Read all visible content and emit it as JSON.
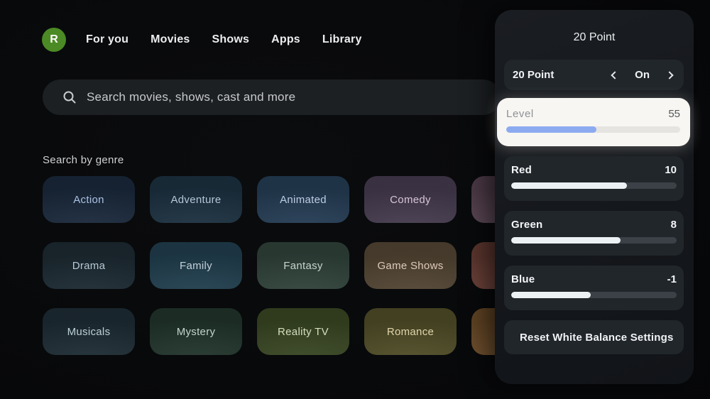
{
  "header": {
    "avatar": {
      "letter": "R",
      "bg": "#4b8a25"
    },
    "nav_items": [
      {
        "label": "For you"
      },
      {
        "label": "Movies"
      },
      {
        "label": "Shows"
      },
      {
        "label": "Apps"
      },
      {
        "label": "Library"
      }
    ]
  },
  "search": {
    "placeholder": "Search movies, shows, cast and more"
  },
  "genres": {
    "title": "Search by genre",
    "tiles": [
      {
        "label": "Action",
        "bg": "#1b2a3d",
        "fg": "#aac2e4"
      },
      {
        "label": "Adventure",
        "bg": "#1d3242",
        "fg": "#b4c8d8"
      },
      {
        "label": "Animated",
        "bg": "#263e56",
        "fg": "#bccde6"
      },
      {
        "label": "Comedy",
        "bg": "#463c50",
        "fg": "#d6c4da"
      },
      {
        "label": "",
        "bg": "#5c4655",
        "fg": "#d6c4da"
      },
      {
        "label": "Drama",
        "bg": "#1d2b33",
        "fg": "#b7c9d6"
      },
      {
        "label": "Family",
        "bg": "#224050",
        "fg": "#c1d1d8"
      },
      {
        "label": "Fantasy",
        "bg": "#31443c",
        "fg": "#c6d4cc"
      },
      {
        "label": "Game Shows",
        "bg": "#544634",
        "fg": "#decbbb"
      },
      {
        "label": "",
        "bg": "#6f4138",
        "fg": "#ffffff"
      },
      {
        "label": "Musicals",
        "bg": "#1e2d35",
        "fg": "#bdd1d8"
      },
      {
        "label": "Mystery",
        "bg": "#22362d",
        "fg": "#c3d4cc"
      },
      {
        "label": "Reality TV",
        "bg": "#3a4824",
        "fg": "#d5debe"
      },
      {
        "label": "Romance",
        "bg": "#514e28",
        "fg": "#e1d5ac"
      },
      {
        "label": "",
        "bg": "#74512b",
        "fg": "#ffffff"
      }
    ]
  },
  "panel": {
    "title": "20 Point",
    "selector": {
      "label": "20 Point",
      "value": "On"
    },
    "sliders": [
      {
        "label": "Level",
        "value": "55",
        "fill_pct": 52,
        "focused": true
      },
      {
        "label": "Red",
        "value": "10",
        "fill_pct": 70,
        "focused": false
      },
      {
        "label": "Green",
        "value": "8",
        "fill_pct": 66,
        "focused": false
      },
      {
        "label": "Blue",
        "value": "-1",
        "fill_pct": 48,
        "focused": false
      }
    ],
    "reset_label": "Reset White Balance Settings",
    "colors": {
      "panel_bg_top": "#1a1d22",
      "panel_bg_bottom": "#14171b",
      "card_bg": "#21262b",
      "focus_bg": "#f8f6f2",
      "focus_label": "#8d9196",
      "focus_value": "#54585d",
      "level_fill": "#8caaf0",
      "track_light": "#e6e4e0",
      "slider_fill": "#ecf1f4",
      "track_dark": "#3b4147"
    }
  }
}
